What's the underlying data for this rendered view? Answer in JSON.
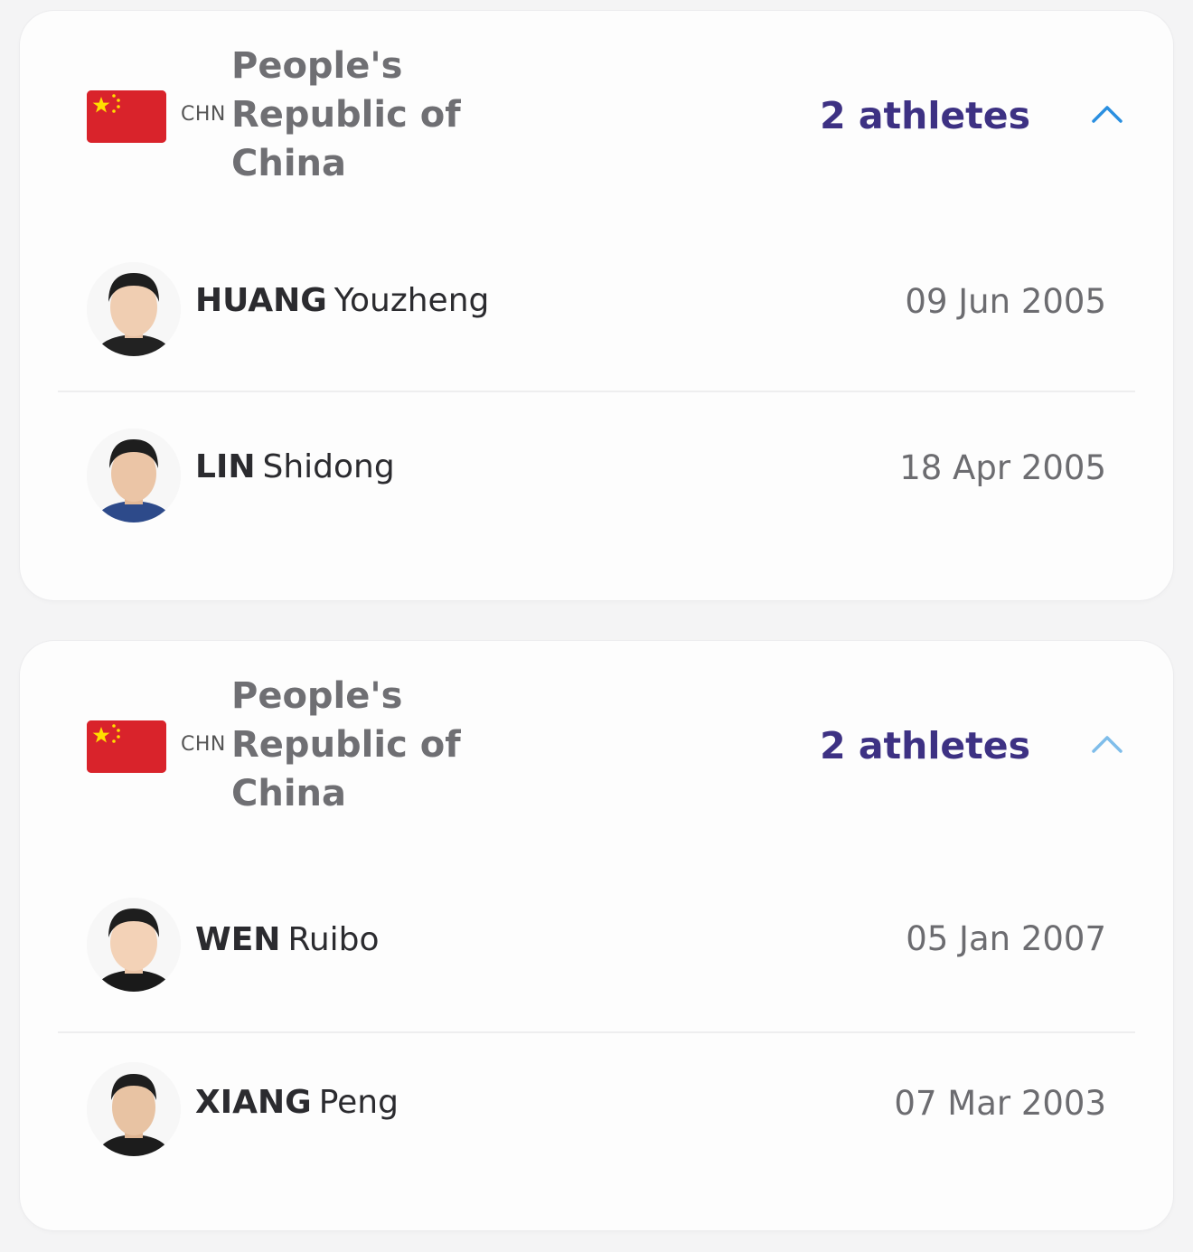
{
  "groups": [
    {
      "flag_colors": {
        "field": "#d9232b",
        "stars": "#ffde00"
      },
      "country_code": "CHN",
      "country_name": "People's Republic of China",
      "athlete_count": "2 athletes",
      "count_color": "#3d3183",
      "chevron_icon": "chevron-up-icon",
      "athletes": [
        {
          "surname": "HUANG",
          "given_name": "Youzheng",
          "dob": "09 Jun 2005",
          "avatar_icon": "athlete-photo"
        },
        {
          "surname": "LIN",
          "given_name": "Shidong",
          "dob": "18 Apr 2005",
          "avatar_icon": "athlete-photo"
        }
      ]
    },
    {
      "flag_colors": {
        "field": "#d9232b",
        "stars": "#ffde00"
      },
      "country_code": "CHN",
      "country_name": "People's Republic of China",
      "athlete_count": "2 athletes",
      "count_color": "#3d3183",
      "chevron_icon": "chevron-up-icon",
      "athletes": [
        {
          "surname": "WEN",
          "given_name": "Ruibo",
          "dob": "05 Jan 2007",
          "avatar_icon": "athlete-photo"
        },
        {
          "surname": "XIANG",
          "given_name": "Peng",
          "dob": "07 Mar 2003",
          "avatar_icon": "athlete-photo"
        }
      ]
    }
  ]
}
